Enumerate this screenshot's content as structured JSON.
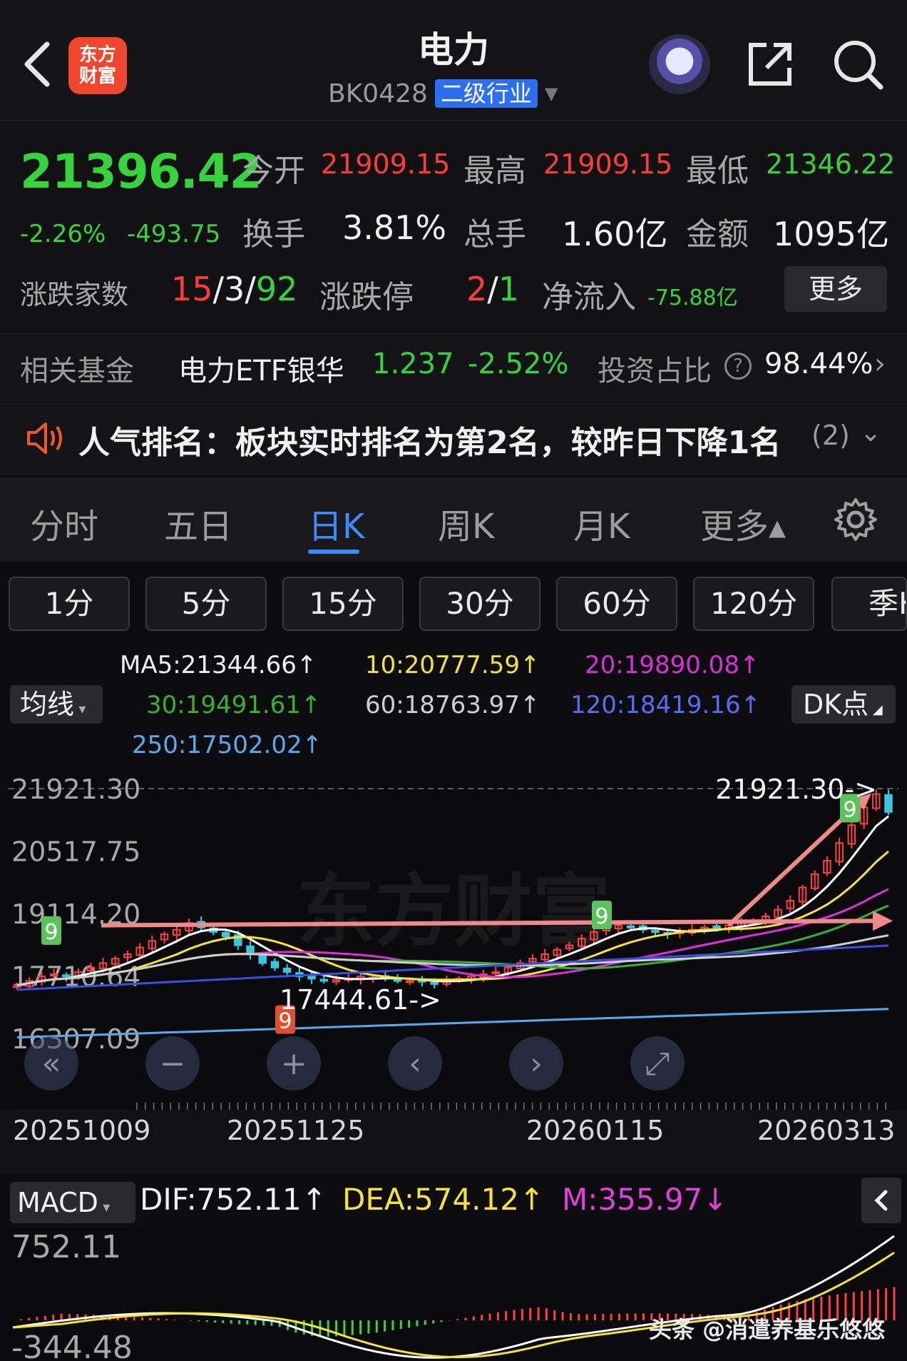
{
  "header": {
    "title": "电力",
    "code": "BK0428",
    "level_badge": "二级行业",
    "logo_line1": "东方",
    "logo_line2": "财富"
  },
  "quote": {
    "price": "21396.42",
    "change_pct": "-2.26%",
    "change_val": "-493.75",
    "open_label": "今开",
    "open": "21909.15",
    "high_label": "最高",
    "high": "21909.15",
    "low_label": "最低",
    "low": "21346.22",
    "turnover_label": "换手",
    "turnover": "3.81%",
    "volume_label": "总手",
    "volume": "1.60亿",
    "amount_label": "金额",
    "amount": "1095亿",
    "breadth_label": "涨跌家数",
    "breadth_up": "15",
    "breadth_flat": "3",
    "breadth_down": "92",
    "limit_label": "涨跌停",
    "limit_up": "2",
    "limit_down": "1",
    "netflow_label": "净流入",
    "netflow": "-75.88亿",
    "more_button": "更多",
    "sep": "/"
  },
  "fund": {
    "label": "相关基金",
    "name": "电力ETF银华",
    "price": "1.237",
    "change": "-2.52%",
    "ratio_label": "投资占比",
    "ratio": "98.44%"
  },
  "popularity": {
    "text": "人气排名：板块实时排名为第2名，较昨日下降1名",
    "count": "(2)"
  },
  "tabs": [
    "分时",
    "五日",
    "日K",
    "周K",
    "月K",
    "更多▴"
  ],
  "periods": [
    "1分",
    "5分",
    "15分",
    "30分",
    "60分",
    "120分",
    "季K"
  ],
  "ma": {
    "button": "均线",
    "ma5": "MA5:21344.66↑",
    "ma10": "10:20777.59↑",
    "ma20": "20:19890.08↑",
    "ma30": "30:19491.61↑",
    "ma60": "60:18763.97↑",
    "ma120": "120:18419.16↑",
    "ma250": "250:17502.02↑",
    "dk_button": "DK点"
  },
  "colors": {
    "up": "#ff3b3b",
    "down": "#36d33d",
    "ma5": "#ffffff",
    "ma10": "#f5e33b",
    "ma20": "#d930d9",
    "ma30": "#36b136",
    "ma60": "#cfcfcf",
    "ma120": "#3a4fe0",
    "ma250": "#5aa8ee"
  },
  "chart_data": {
    "type": "candlestick",
    "y_ticks": [
      "21921.30",
      "20517.75",
      "19114.20",
      "17710.64",
      "16307.09"
    ],
    "ylim": [
      16307.09,
      21921.3
    ],
    "x_ticks": [
      "20251009",
      "20251125",
      "20260115",
      "20260313"
    ],
    "annotations": {
      "high_marker": "21921.30->",
      "low_marker": "17444.61->",
      "td_nine": "9"
    },
    "close_approx": [
      17500,
      17600,
      17700,
      17750,
      17700,
      17800,
      17900,
      18000,
      18100,
      18200,
      18350,
      18500,
      18650,
      18750,
      18900,
      18800,
      18700,
      18600,
      18400,
      18200,
      18000,
      17900,
      17800,
      17700,
      17650,
      17600,
      17620,
      17650,
      17700,
      17680,
      17650,
      17620,
      17600,
      17580,
      17550,
      17600,
      17650,
      17700,
      17750,
      17800,
      17900,
      18000,
      18100,
      18200,
      18300,
      18400,
      18550,
      18700,
      18800,
      18850,
      18800,
      18750,
      18700,
      18650,
      18700,
      18750,
      18800,
      18800,
      18850,
      18900,
      18950,
      19050,
      19200,
      19400,
      19700,
      20000,
      20300,
      20700,
      21100,
      21500,
      21800,
      21396
    ]
  },
  "macd": {
    "button": "MACD",
    "dif": "DIF:752.11↑",
    "dea": "DEA:574.12↑",
    "m": "M:355.97↓",
    "y_top": "752.11",
    "y_bottom": "-344.48"
  },
  "watermark": {
    "chart": "东方财富",
    "toutiao": "头条 @消遣养基乐悠悠"
  }
}
